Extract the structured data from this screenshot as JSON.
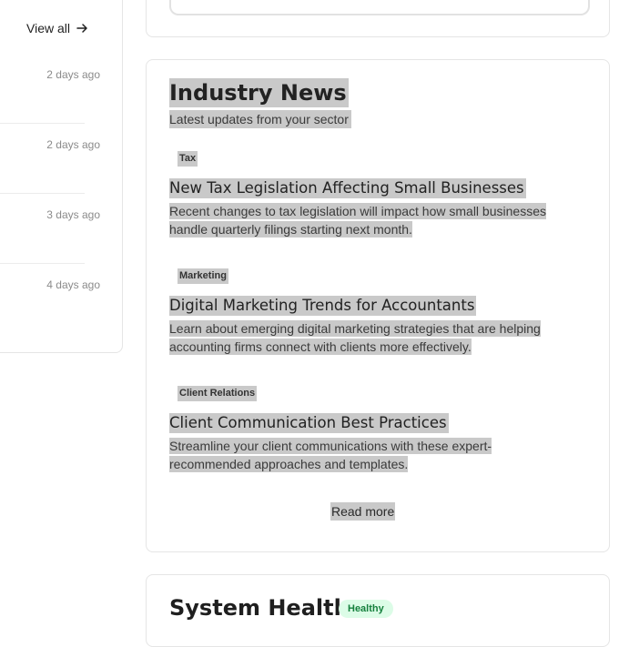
{
  "activity": {
    "view_all_label": "View all",
    "items": [
      {
        "time": "2 days ago"
      },
      {
        "time": "2 days ago"
      },
      {
        "time": "3 days ago"
      },
      {
        "time": "4 days ago"
      }
    ]
  },
  "news": {
    "title": "Industry News",
    "subtitle": "Latest updates from your sector",
    "articles": [
      {
        "tag": "Tax",
        "title": "New Tax Legislation Affecting Small Businesses",
        "line1": "Recent changes to tax legislation will impact how small businesses",
        "line2": "handle quarterly filings starting next month."
      },
      {
        "tag": "Marketing",
        "title": "Digital Marketing Trends for Accountants",
        "line1": "Learn about emerging digital marketing strategies that are helping",
        "line2": "accounting firms connect with clients more effectively."
      },
      {
        "tag": "Client Relations",
        "title": "Client Communication Best Practices",
        "line1": "Streamline your client communications with these expert-",
        "line2": "recommended approaches and templates."
      }
    ],
    "read_more_label": "Read more"
  },
  "system_health": {
    "title": "System Health",
    "status": "Healthy"
  },
  "colors": {
    "selection_highlight": "#c9c9c9",
    "healthy_badge_bg": "#dcfce7",
    "healthy_badge_text": "#15803d"
  }
}
